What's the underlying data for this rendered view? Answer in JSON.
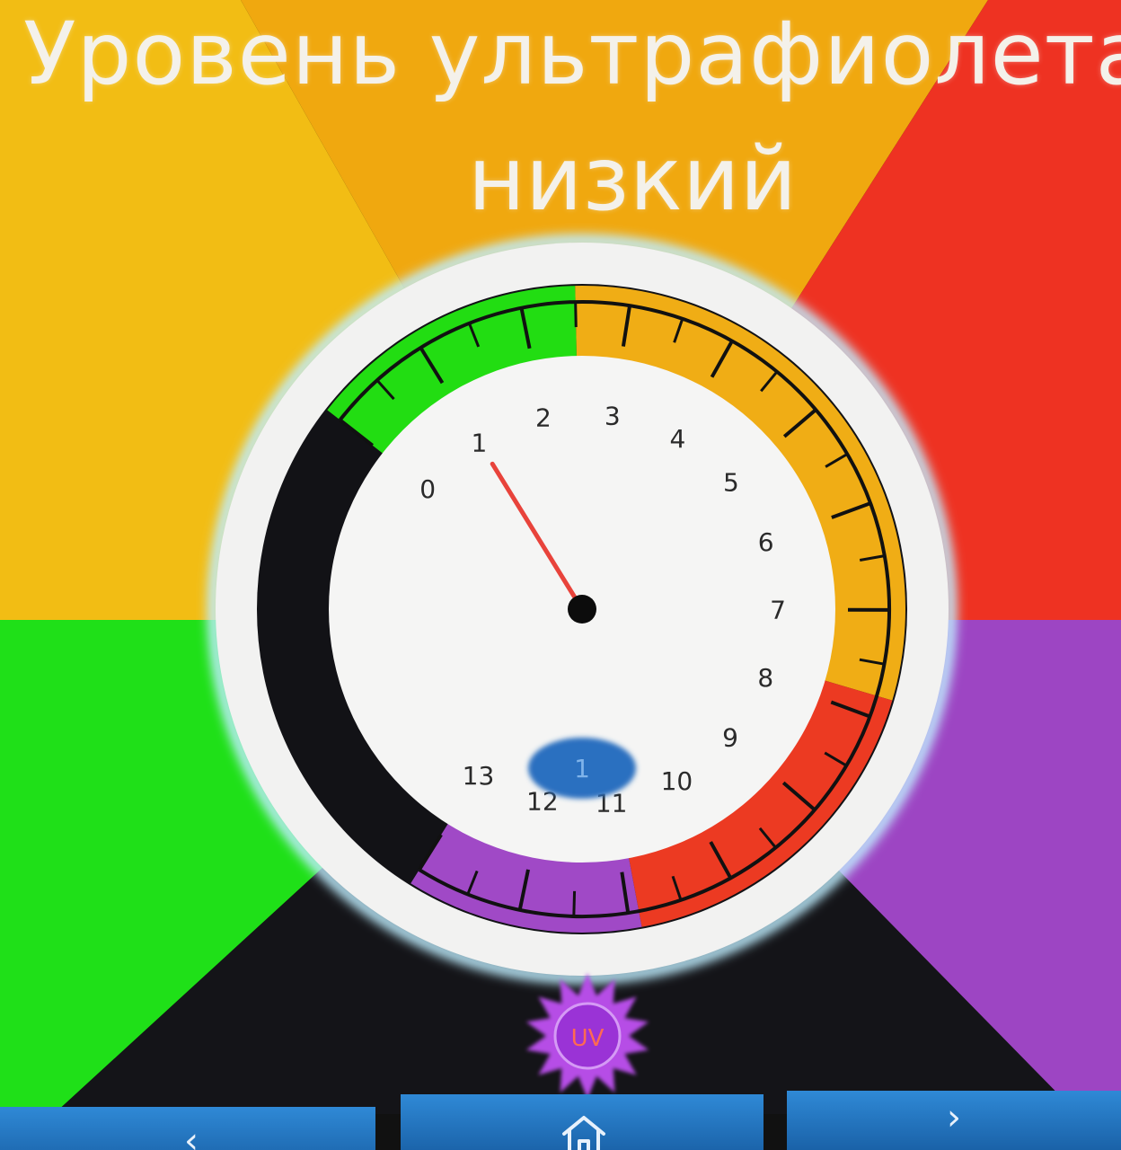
{
  "title": {
    "line1": "Уровень ультрафиолета",
    "line2": "низкий"
  },
  "gauge": {
    "min": 0,
    "max": 13,
    "value": 1,
    "scale_labels": [
      "0",
      "1",
      "2",
      "3",
      "4",
      "5",
      "6",
      "7",
      "8",
      "9",
      "10",
      "11",
      "12",
      "13"
    ],
    "value_label": "1",
    "zones": [
      {
        "name": "low",
        "from": 0,
        "to": 2.5,
        "color": "#22dd12"
      },
      {
        "name": "moderate",
        "from": 2.5,
        "to": 7.8,
        "color": "#f0ad15"
      },
      {
        "name": "high",
        "from": 7.8,
        "to": 10.9,
        "color": "#ec3a22"
      },
      {
        "name": "extreme",
        "from": 10.9,
        "to": 13,
        "color": "#a049c6"
      }
    ],
    "needle_color": "#e8433b",
    "value_badge_color": "#2b6fc0"
  },
  "background": {
    "colors": {
      "yellow": "#f2bd14",
      "orange": "#f0a80f",
      "red": "#ee3222",
      "green": "#1fe018",
      "purple": "#9d45c3",
      "black": "#141418"
    }
  },
  "uv_badge": {
    "label": "UV",
    "icon": "uv-sun-icon",
    "color": "#b64ee6"
  },
  "nav": {
    "back_glyph": "‹",
    "home_icon": "home-icon",
    "next_glyph": "›"
  }
}
